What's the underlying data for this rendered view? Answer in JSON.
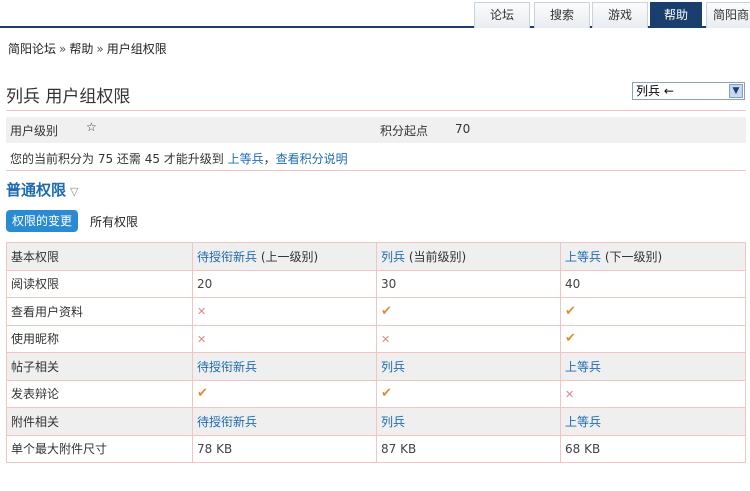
{
  "nav": {
    "tabs": [
      {
        "label": "论坛",
        "active": false
      },
      {
        "label": "搜索",
        "active": false
      },
      {
        "label": "游戏",
        "active": false
      },
      {
        "label": "帮助",
        "active": true
      },
      {
        "label": "简阳商"
      }
    ]
  },
  "breadcrumb": [
    "简阳论坛",
    "帮助",
    "用户组权限"
  ],
  "breadcrumb_sep": "»",
  "page_title": "列兵 用户组权限",
  "group_select": {
    "value": "列兵 ←",
    "arrow": "▼"
  },
  "info": {
    "level_label": "用户级别",
    "level_icon": "star-icon",
    "score_label": "积分起点",
    "score_value": "70"
  },
  "score_line": {
    "text": "您的当前积分为 75 还需 45 才能升级到",
    "next_group": "上等兵",
    "sep": "，",
    "explain_link": "查看积分说明"
  },
  "section": {
    "title": "普通权限",
    "toggle": "▽"
  },
  "tabs": {
    "changes": "权限的变更",
    "all": "所有权限"
  },
  "table": {
    "rows": [
      {
        "type": "head",
        "cells": [
          {
            "text": "基本权限"
          },
          {
            "link": "待授衔新兵",
            "suffix": " (上一级别)"
          },
          {
            "link": "列兵",
            "suffix": " (当前级别)"
          },
          {
            "link": "上等兵",
            "suffix": " (下一级别)"
          }
        ]
      },
      {
        "type": "row",
        "cells": [
          {
            "text": "阅读权限"
          },
          {
            "text": "20"
          },
          {
            "text": "30"
          },
          {
            "text": "40"
          }
        ]
      },
      {
        "type": "row",
        "cells": [
          {
            "text": "查看用户资料"
          },
          {
            "mark": "cross"
          },
          {
            "mark": "check"
          },
          {
            "mark": "check"
          }
        ]
      },
      {
        "type": "row",
        "cells": [
          {
            "text": "使用昵称"
          },
          {
            "mark": "cross"
          },
          {
            "mark": "cross"
          },
          {
            "mark": "check"
          }
        ]
      },
      {
        "type": "head",
        "cells": [
          {
            "text": "帖子相关"
          },
          {
            "link": "待授衔新兵"
          },
          {
            "link": "列兵"
          },
          {
            "link": "上等兵"
          }
        ]
      },
      {
        "type": "row",
        "cells": [
          {
            "text": "发表辩论"
          },
          {
            "mark": "check"
          },
          {
            "mark": "check"
          },
          {
            "mark": "cross"
          }
        ]
      },
      {
        "type": "head",
        "cells": [
          {
            "text": "附件相关"
          },
          {
            "link": "待授衔新兵"
          },
          {
            "link": "列兵"
          },
          {
            "link": "上等兵"
          }
        ]
      },
      {
        "type": "row",
        "cells": [
          {
            "text": "单个最大附件尺寸"
          },
          {
            "text": "78 KB"
          },
          {
            "text": "87 KB"
          },
          {
            "text": "68 KB"
          }
        ]
      }
    ]
  },
  "marks": {
    "check": "✔",
    "cross": "✕"
  },
  "colors": {
    "accent": "#1f6bb3",
    "nav_active": "#1a3e6e",
    "pill": "#2a8bd1",
    "border": "#f3c4c4",
    "check": "#d9903a",
    "cross": "#d98a8a"
  }
}
